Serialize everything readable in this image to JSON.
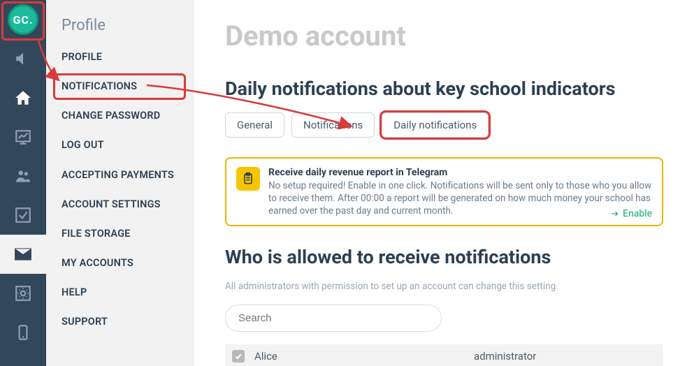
{
  "avatar": {
    "initials": "GC."
  },
  "sidebar": {
    "title": "Profile",
    "items": [
      {
        "label": "PROFILE"
      },
      {
        "label": "NOTIFICATIONS"
      },
      {
        "label": "CHANGE PASSWORD"
      },
      {
        "label": "LOG OUT"
      },
      {
        "label": "ACCEPTING PAYMENTS"
      },
      {
        "label": "ACCOUNT SETTINGS"
      },
      {
        "label": "FILE STORAGE"
      },
      {
        "label": "MY ACCOUNTS"
      },
      {
        "label": "HELP"
      },
      {
        "label": "SUPPORT"
      }
    ]
  },
  "main": {
    "page_title": "Demo account",
    "section_title": "Daily notifications about key school indicators",
    "tabs": [
      {
        "label": "General"
      },
      {
        "label": "Notifications"
      },
      {
        "label": "Daily notifications"
      }
    ],
    "callout": {
      "title": "Receive daily revenue report in Telegram",
      "text": "No setup required! Enable in one click. Notifications will be sent only to those who you allow to receive them. After 00:00 a report will be generated on how much money your school has earned over the past day and current month.",
      "action": "Enable"
    },
    "who_title": "Who is allowed to receive notifications",
    "who_sub": "All administrators with permission to set up an account can change this setting",
    "search_placeholder": "Search",
    "user": {
      "name": "Alice",
      "role": "administrator"
    }
  }
}
